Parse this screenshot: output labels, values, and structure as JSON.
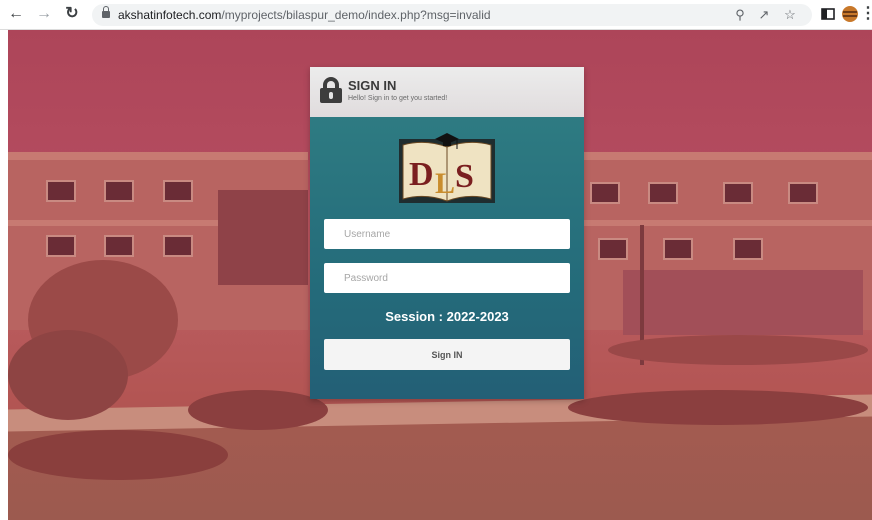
{
  "browser": {
    "url_host": "akshatinfotech.com",
    "url_path": "/myprojects/bilaspur_demo/index.php?msg=invalid",
    "back_icon": "arrow-left-icon",
    "forward_icon": "arrow-right-icon",
    "reload_icon": "reload-icon"
  },
  "login": {
    "title": "SIGN IN",
    "subtitle": "Hello! Sign in to get you started!",
    "username_placeholder": "Username",
    "password_placeholder": "Password",
    "session_text": "Session : 2022-2023",
    "signin_label": "Sign IN",
    "logo_text": "DLS"
  },
  "colors": {
    "overlay": "#b04a5c",
    "card_body": "#2e7b82",
    "card_header": "#e6e3e4"
  }
}
